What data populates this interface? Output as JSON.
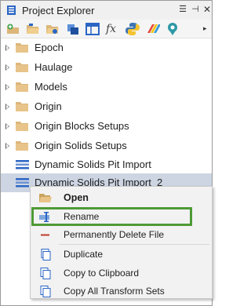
{
  "window": {
    "title": "Project Explorer"
  },
  "titlebar": {
    "menu_glyph": "☰",
    "pin_glyph": "⊣",
    "close_glyph": "✕"
  },
  "toolbar": {
    "buttons": [
      {
        "name": "add-project-icon"
      },
      {
        "name": "open-folder-icon"
      },
      {
        "name": "folder-link-icon"
      },
      {
        "name": "stack-icon"
      },
      {
        "name": "grid-icon"
      },
      {
        "name": "function-icon",
        "glyph": "fx"
      },
      {
        "name": "python-icon"
      },
      {
        "name": "palette-icon"
      },
      {
        "name": "location-icon"
      }
    ],
    "more_glyph": "▸"
  },
  "tree": {
    "items": [
      {
        "label": "Epoch",
        "type": "folder"
      },
      {
        "label": "Haulage",
        "type": "folder"
      },
      {
        "label": "Models",
        "type": "folder"
      },
      {
        "label": "Origin",
        "type": "folder"
      },
      {
        "label": "Origin Blocks Setups",
        "type": "folder"
      },
      {
        "label": "Origin Solids Setups",
        "type": "folder"
      },
      {
        "label": "Dynamic Solids Pit Import",
        "type": "layers"
      },
      {
        "label": "Dynamic Solids Pit Import_2",
        "type": "layers",
        "selected": true
      }
    ]
  },
  "context_menu": {
    "items": [
      {
        "label": "Open",
        "icon": "open-folder-icon",
        "bold": true
      },
      {
        "label": "Rename",
        "icon": "rename-icon"
      },
      {
        "label": "Permanently Delete File",
        "icon": "delete-icon"
      },
      {
        "label": "Duplicate",
        "icon": "duplicate-icon"
      },
      {
        "label": "Copy to Clipboard",
        "icon": "copy-clipboard-icon"
      },
      {
        "label": "Copy All Transform Sets",
        "icon": "copy-transform-icon"
      }
    ]
  },
  "colors": {
    "selection": "#cdd5e3",
    "highlight_border": "#4e9a36",
    "folder": "#dcb67a",
    "accent_blue": "#2b66c4",
    "delete_red": "#c0392b"
  }
}
